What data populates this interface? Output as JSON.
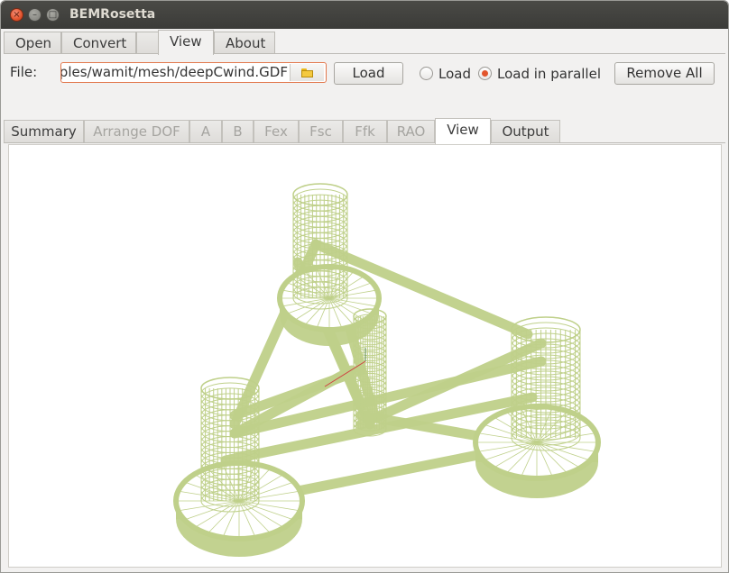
{
  "window": {
    "title": "BEMRosetta",
    "controls": {
      "close": "×",
      "minimize": "–",
      "maximize": "□"
    }
  },
  "menu_tabs": [
    "Open",
    "Convert",
    "",
    "View",
    "About"
  ],
  "menu_active": "View",
  "file_row": {
    "label": "File:",
    "path_value": "nples/wamit/mesh/deepCwind.GDF",
    "folder_icon": "folder-icon",
    "load_button": "Load",
    "radio_load": "Load",
    "radio_parallel": "Load in parallel",
    "radio_selected": "Load in parallel",
    "remove_all_button": "Remove All"
  },
  "sub_tabs": [
    "Summary",
    "Arrange DOF",
    "A",
    "B",
    "Fex",
    "Fsc",
    "Ffk",
    "RAO",
    "View",
    "Output"
  ],
  "sub_tabs_disabled": [
    "Arrange DOF",
    "A",
    "B",
    "Fex",
    "Fsc",
    "Ffk",
    "RAO"
  ],
  "sub_active": "View",
  "viewport": {
    "content": "deepCwind mesh wireframe",
    "mesh_color": "#bfd08a",
    "axis_color": "#d04040"
  },
  "colors": {
    "accent": "#e2552c",
    "titlebar": "#3c3b37",
    "window_bg": "#f2f1f0"
  }
}
